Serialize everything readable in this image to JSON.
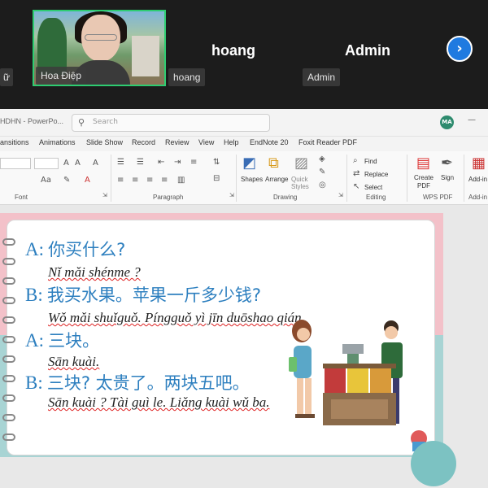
{
  "meeting": {
    "participants": [
      {
        "name_tag": "Hoa Điệp"
      },
      {
        "name": "hoang",
        "name_tag": "hoang"
      },
      {
        "name": "Admin",
        "name_tag": "Admin"
      }
    ],
    "left_tag": "ữ",
    "next_icon": "›"
  },
  "ppt": {
    "title_fragment": "HDHN - PowerPo...",
    "search_placeholder": "Search",
    "avatar_initials": "MA",
    "minimize_glyph": "—",
    "tabs": [
      "ansitions",
      "Animations",
      "Slide Show",
      "Record",
      "Review",
      "View",
      "Help",
      "EndNote 20",
      "Foxit Reader PDF"
    ],
    "ribbon": {
      "groups": [
        "Font",
        "Paragraph",
        "Drawing",
        "Editing",
        "WPS PDF",
        "Add-in"
      ],
      "drawing": {
        "shapes": "Shapes",
        "arrange": "Arrange",
        "quick_styles": "Quick Styles"
      },
      "editing": {
        "find": "Find",
        "replace": "Replace",
        "select": "Select"
      },
      "wps": {
        "create_pdf": "Create PDF",
        "sign": "Sign"
      },
      "addin": "Add-in"
    }
  },
  "slide": {
    "lines": [
      {
        "label": "A:",
        "hanzi": "你买什么?"
      },
      {
        "pinyin": "Nǐ mǎi shénme ?"
      },
      {
        "label": "B:",
        "hanzi": "我买水果。苹果一斤多少钱?"
      },
      {
        "pinyin": "Wǒ mǎi shuǐguǒ. Píngguǒ yì jīn duōshao qián."
      },
      {
        "label": "A:",
        "hanzi": "三块。"
      },
      {
        "pinyin": "Sān kuài."
      },
      {
        "label": "B:",
        "hanzi": "三块? 太贵了。两块五吧。"
      },
      {
        "pinyin": "Sān kuài ? Tài guì le. Liǎng kuài wǔ ba."
      }
    ]
  },
  "colors": {
    "accent": "#2d7fbf",
    "green_border": "#2ecc71",
    "next_button": "#1f7ae0"
  }
}
